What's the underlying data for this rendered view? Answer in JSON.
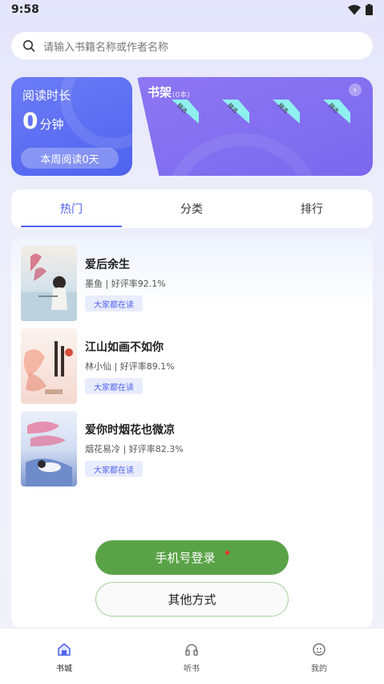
{
  "status_bar": {
    "time": "9:58",
    "icons": [
      "wifi-icon",
      "battery-icon"
    ]
  },
  "search": {
    "placeholder": "请输入书籍名称或作者名称",
    "icon": "search-icon"
  },
  "reading_card": {
    "title": "阅读时长",
    "value": "0",
    "unit": "分钟",
    "week_button": "本周阅读0天"
  },
  "bookshelf_card": {
    "title": "书架",
    "count": "(0本)",
    "tags": [
      "精选",
      "精选",
      "精选",
      "精选"
    ]
  },
  "tabs": [
    {
      "label": "热门",
      "active": true
    },
    {
      "label": "分类",
      "active": false
    },
    {
      "label": "排行",
      "active": false
    }
  ],
  "books": [
    {
      "title": "爱后余生",
      "meta": "墨鱼 | 好评率92.1%",
      "tag": "大家都在读"
    },
    {
      "title": "江山如画不如你",
      "meta": "林小仙 | 好评率89.1%",
      "tag": "大家都在读"
    },
    {
      "title": "爱你时烟花也微凉",
      "meta": "烟花易冷 | 好评率82.3%",
      "tag": "大家都在读"
    }
  ],
  "login": {
    "phone_button": "手机号登录",
    "other_button": "其他方式"
  },
  "bottom_nav": [
    {
      "label": "书城",
      "icon": "bookstore-icon",
      "active": true
    },
    {
      "label": "听书",
      "icon": "headphones-icon",
      "active": false
    },
    {
      "label": "我的",
      "icon": "profile-icon",
      "active": false
    }
  ],
  "colors": {
    "accent": "#4f63ee",
    "shelf": "#7a68ee",
    "login_green": "#5aa247"
  }
}
